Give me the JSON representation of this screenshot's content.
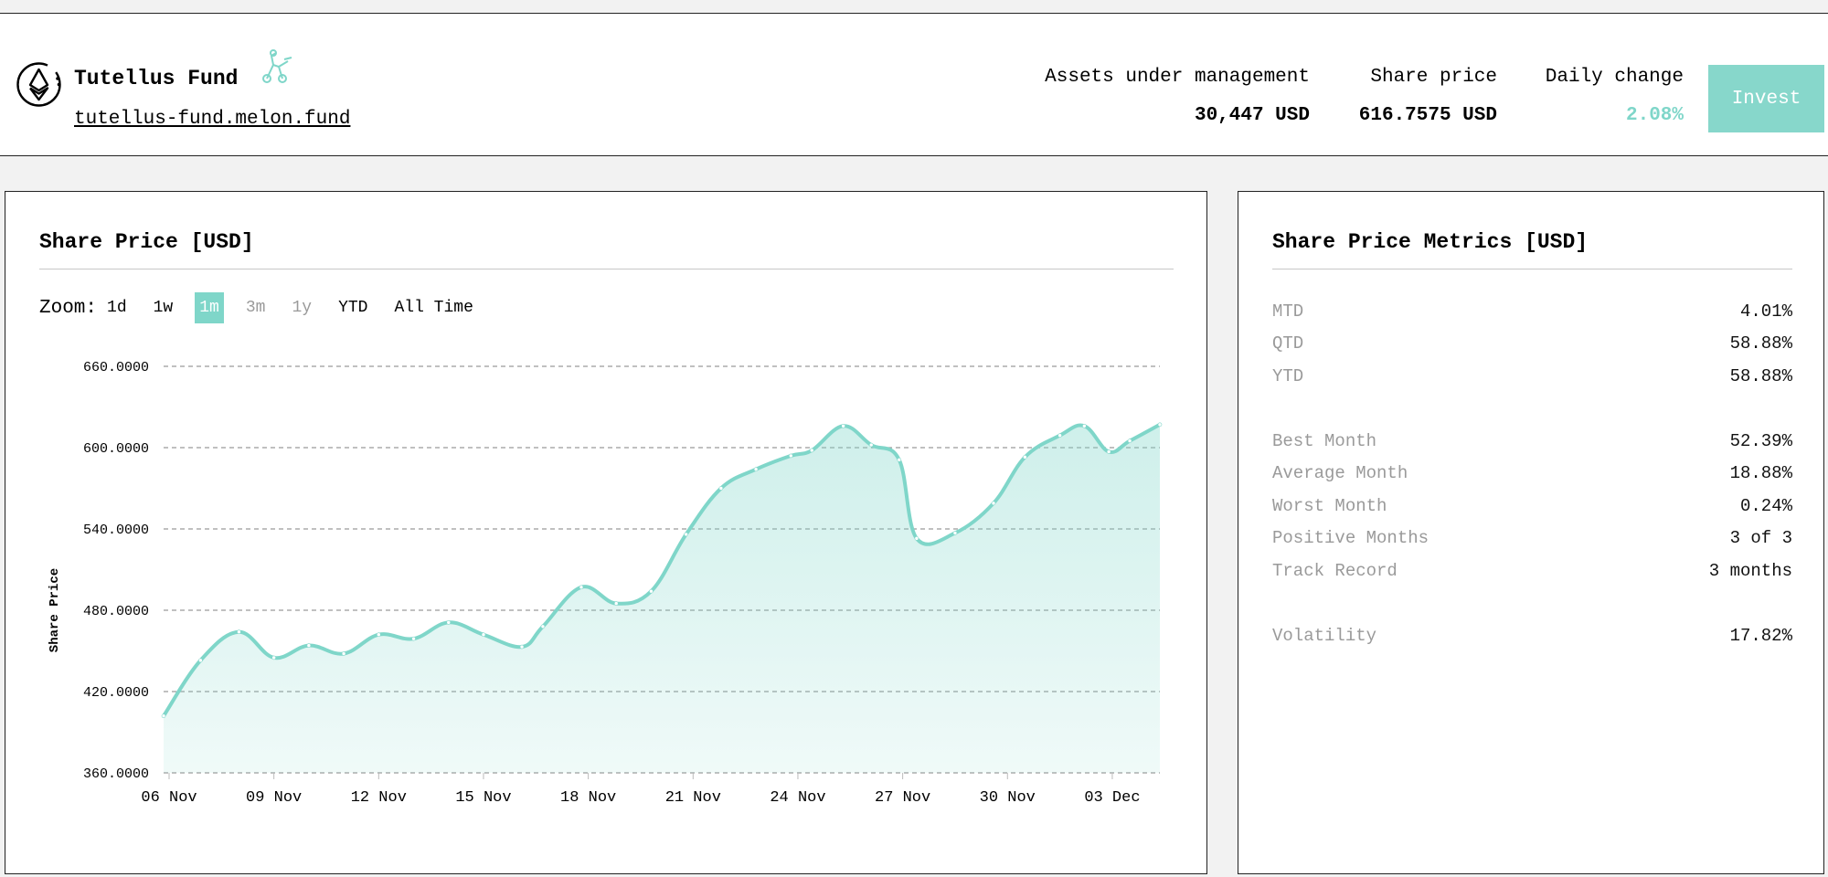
{
  "header": {
    "fund_name": "Tutellus Fund",
    "fund_link": "tutellus-fund.melon.fund",
    "aum_label": "Assets under management",
    "aum_value": "30,447 USD",
    "price_label": "Share price",
    "price_value": "616.7575 USD",
    "change_label": "Daily change",
    "change_value": "2.08%",
    "invest_label": "Invest"
  },
  "chart_panel": {
    "title": "Share Price [USD]",
    "zoom_label": "Zoom:",
    "zoom_options": [
      {
        "label": "1d",
        "state": "enabled"
      },
      {
        "label": "1w",
        "state": "enabled"
      },
      {
        "label": "1m",
        "state": "active"
      },
      {
        "label": "3m",
        "state": "disabled"
      },
      {
        "label": "1y",
        "state": "disabled"
      },
      {
        "label": "YTD",
        "state": "enabled"
      },
      {
        "label": "All Time",
        "state": "enabled"
      }
    ]
  },
  "chart_data": {
    "type": "area",
    "ylabel": "Share Price",
    "ylim": [
      360,
      660
    ],
    "y_ticks": [
      "660.0000",
      "600.0000",
      "540.0000",
      "480.0000",
      "420.0000",
      "360.0000"
    ],
    "x_ticks": [
      {
        "label": "06 Nov",
        "x": 0
      },
      {
        "label": "09 Nov",
        "x": 3
      },
      {
        "label": "12 Nov",
        "x": 6
      },
      {
        "label": "15 Nov",
        "x": 9
      },
      {
        "label": "18 Nov",
        "x": 12
      },
      {
        "label": "21 Nov",
        "x": 15
      },
      {
        "label": "24 Nov",
        "x": 18
      },
      {
        "label": "27 Nov",
        "x": 21
      },
      {
        "label": "30 Nov",
        "x": 24
      },
      {
        "label": "03 Dec",
        "x": 27
      }
    ],
    "grid": "horizontal-dashed",
    "color": "#7fd6c9",
    "series": [
      {
        "points": [
          [
            -0.2,
            402
          ],
          [
            0.9,
            443
          ],
          [
            2.0,
            464
          ],
          [
            3.0,
            445
          ],
          [
            4.0,
            454
          ],
          [
            5.0,
            448
          ],
          [
            6.0,
            462
          ],
          [
            7.0,
            459
          ],
          [
            8.0,
            471
          ],
          [
            9.0,
            462
          ],
          [
            10.1,
            453
          ],
          [
            10.7,
            468
          ],
          [
            11.8,
            497
          ],
          [
            12.8,
            485
          ],
          [
            13.8,
            494
          ],
          [
            14.8,
            536
          ],
          [
            15.8,
            570
          ],
          [
            16.8,
            584
          ],
          [
            17.8,
            594
          ],
          [
            18.4,
            598
          ],
          [
            19.3,
            616
          ],
          [
            20.1,
            602
          ],
          [
            20.9,
            591
          ],
          [
            21.4,
            533
          ],
          [
            22.5,
            537
          ],
          [
            23.6,
            559
          ],
          [
            24.5,
            593
          ],
          [
            25.5,
            609
          ],
          [
            26.2,
            616
          ],
          [
            26.9,
            597
          ],
          [
            27.5,
            605
          ],
          [
            28.6,
            617
          ]
        ]
      }
    ]
  },
  "metrics_panel": {
    "title": "Share Price Metrics [USD]",
    "groups": [
      [
        {
          "label": "MTD",
          "value": "4.01%"
        },
        {
          "label": "QTD",
          "value": "58.88%"
        },
        {
          "label": "YTD",
          "value": "58.88%"
        }
      ],
      [
        {
          "label": "Best Month",
          "value": "52.39%"
        },
        {
          "label": "Average Month",
          "value": "18.88%"
        },
        {
          "label": "Worst Month",
          "value": "0.24%"
        },
        {
          "label": "Positive Months",
          "value": "3 of 3"
        },
        {
          "label": "Track Record",
          "value": "3 months"
        }
      ],
      [
        {
          "label": "Volatility",
          "value": "17.82%"
        }
      ]
    ]
  }
}
